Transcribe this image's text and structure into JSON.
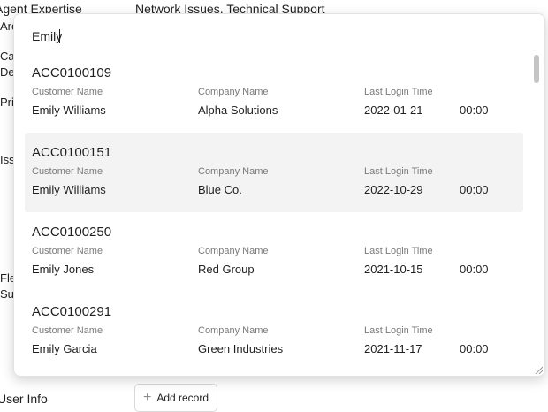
{
  "background_form": {
    "agent_expertise_label": "Agent Expertise",
    "agent_expertise_value": "Network Issues, Technical Support",
    "clipped_labels": [
      "Are",
      "Cat",
      "Des",
      "Pri",
      "Issu",
      "Flex",
      "Sug"
    ],
    "user_info_label": "User Info",
    "add_record_label": "Add record"
  },
  "popup": {
    "search_value": "Emily",
    "field_labels": {
      "customer_name": "Customer Name",
      "company_name": "Company Name",
      "last_login": "Last Login Time"
    },
    "results": [
      {
        "id": "ACC0100109",
        "customer": "Emily Williams",
        "company": "Alpha Solutions",
        "date": "2022-01-21",
        "time": "00:00"
      },
      {
        "id": "ACC0100151",
        "customer": "Emily Williams",
        "company": "Blue Co.",
        "date": "2022-10-29",
        "time": "00:00"
      },
      {
        "id": "ACC0100250",
        "customer": "Emily Jones",
        "company": "Red Group",
        "date": "2021-10-15",
        "time": "00:00"
      },
      {
        "id": "ACC0100291",
        "customer": "Emily Garcia",
        "company": "Green Industries",
        "date": "2021-11-17",
        "time": "00:00"
      }
    ]
  }
}
